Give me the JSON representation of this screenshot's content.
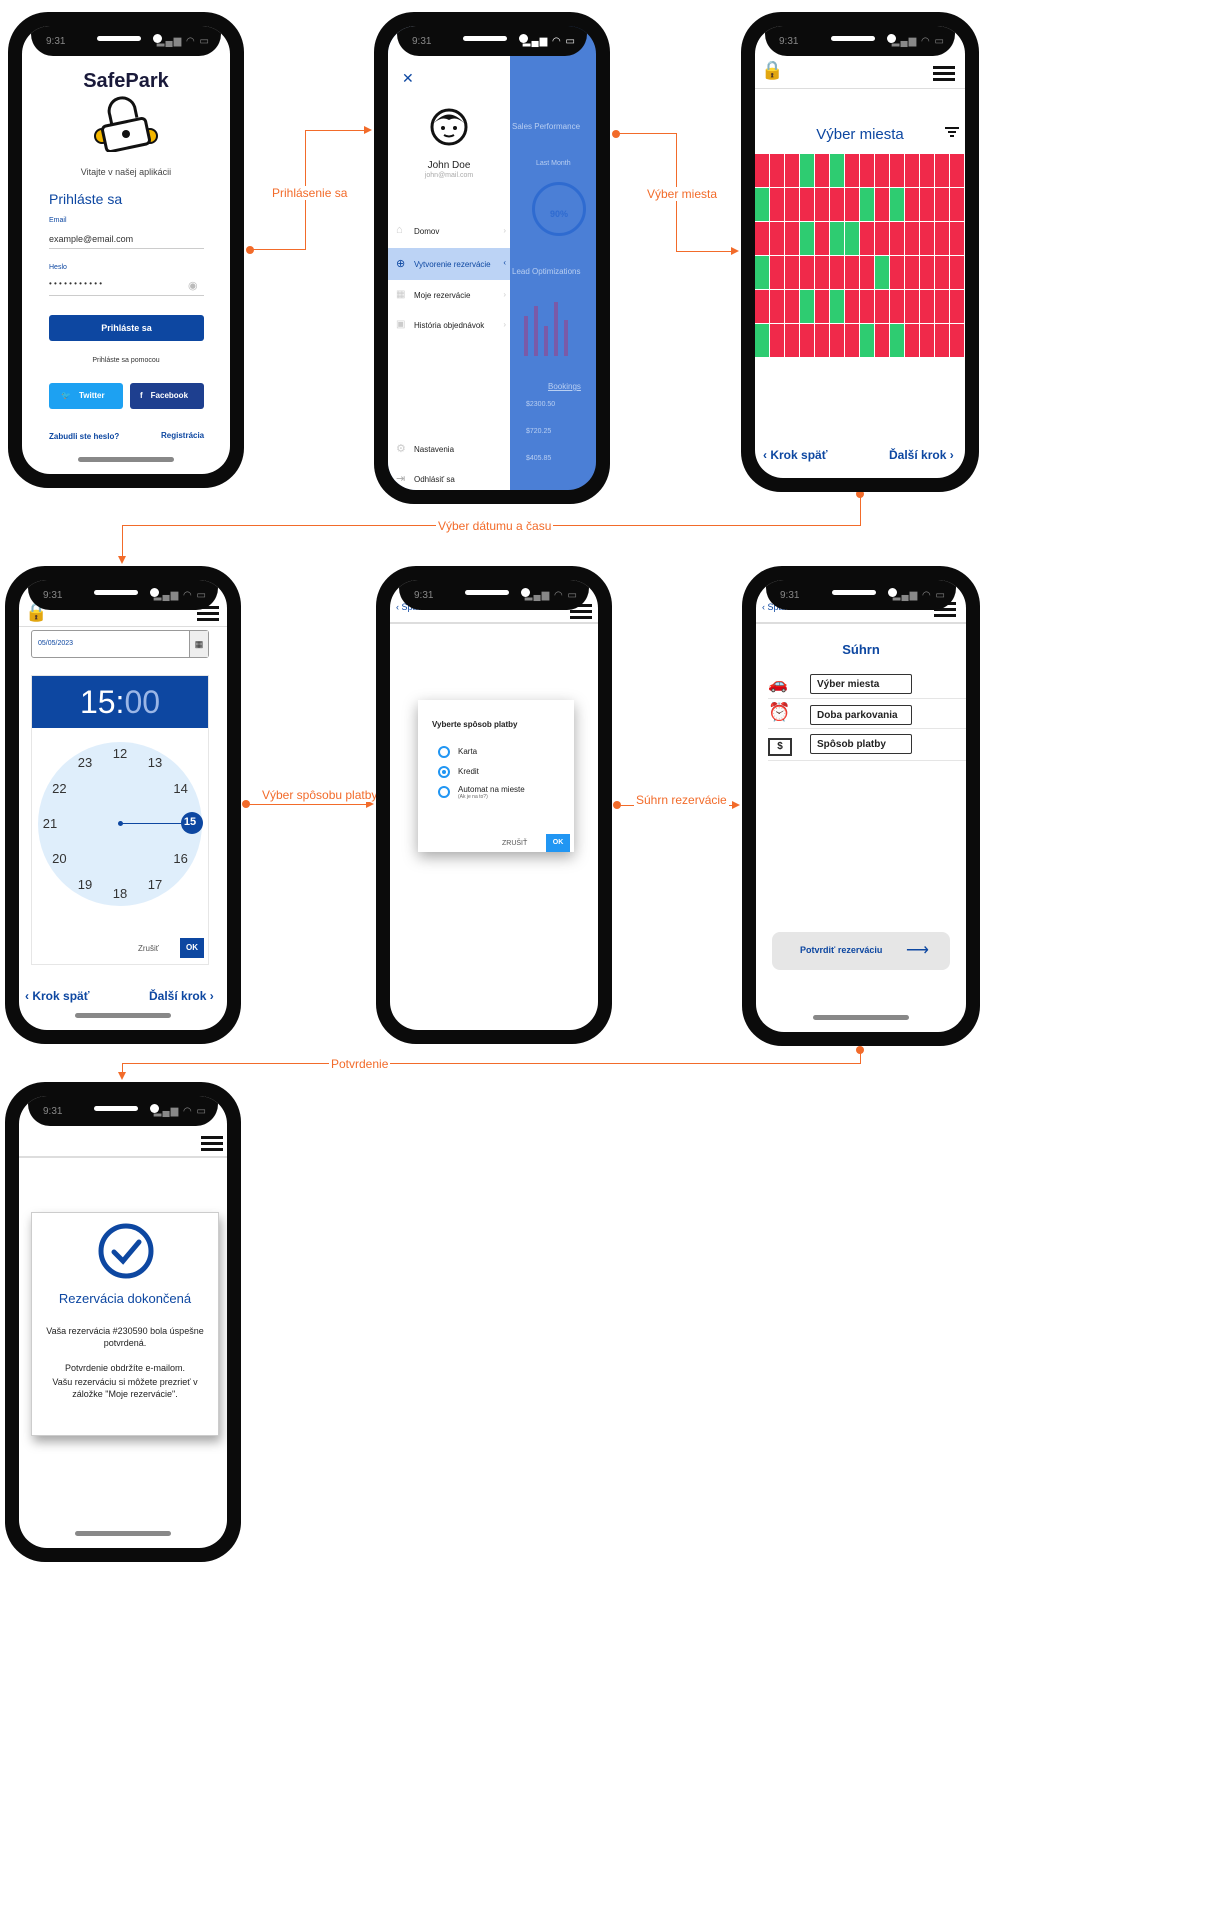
{
  "status_time": "9:31",
  "connectors": {
    "login": "Prihlásenie sa",
    "select_spot": "Výber miesta",
    "date_time": "Výber dátumu a času",
    "payment": "Výber spôsobu platby",
    "summary": "Súhrn rezervácie",
    "confirm": "Potvrdenie"
  },
  "login": {
    "app_name": "SafePark",
    "welcome": "Vitajte v našej aplikácii",
    "title": "Prihláste sa",
    "email_label": "Email",
    "email_value": "example@email.com",
    "password_label": "Heslo",
    "password_value": "• • • • • • • • • • •",
    "login_button": "Prihláste sa",
    "with_label": "Prihláste sa pomocou",
    "twitter": "Twitter",
    "facebook": "Facebook",
    "forgot": "Zabudli ste heslo?",
    "register": "Registrácia"
  },
  "menu": {
    "user_name": "John Doe",
    "user_email": "john@mail.com",
    "items": [
      {
        "label": "Domov"
      },
      {
        "label": "Vytvorenie rezervácie"
      },
      {
        "label": "Moje rezervácie"
      },
      {
        "label": "História objednávok"
      }
    ],
    "settings": "Nastavenia",
    "logout": "Odhlásiť sa",
    "bg_labels": {
      "sales": "Sales Performance",
      "last_month": "Last Month",
      "percent": "90%",
      "lead": "Lead Optimizations",
      "bookings": "Bookings",
      "v1": "$2300.50",
      "v2": "$720.25",
      "v3": "$405.85"
    }
  },
  "spot": {
    "title": "Výber miesta",
    "back": "Krok späť",
    "next": "Ďalší krok",
    "rows": [
      "RRRGRGRRRRRRRR",
      "GRRRRRRGRGRRRR",
      "RRRGRGGRRRRRRR",
      "GRRRRRRRGRRRRR",
      "RRRGRGRRRRRRRR",
      "GRRRRRRGRGRRRR"
    ],
    "colors": {
      "free": "#2ecc71",
      "taken": "#f0294a"
    }
  },
  "datetime": {
    "date_value": "05/05/2023",
    "hour": "15",
    "minute": "00",
    "colon": ":",
    "numbers": [
      "12",
      "13",
      "14",
      "15",
      "16",
      "17",
      "18",
      "19",
      "20",
      "21",
      "22",
      "23"
    ],
    "cancel": "Zrušiť",
    "ok": "OK",
    "back": "Krok späť",
    "next": "Ďalší krok"
  },
  "payment": {
    "back": "Späť",
    "title": "Vyberte spôsob platby",
    "options": [
      {
        "label": "Karta",
        "selected": false
      },
      {
        "label": "Kredit",
        "selected": true
      },
      {
        "label": "Automat na mieste",
        "note": "(Ak je na to?)",
        "selected": false
      }
    ],
    "cancel": "ZRUŠIŤ",
    "ok": "OK"
  },
  "summary": {
    "back": "Späť",
    "title": "Súhrn",
    "rows": [
      {
        "icon": "car-icon",
        "label": "Výber miesta"
      },
      {
        "icon": "alarm-clock-icon",
        "label": "Doba parkovania"
      },
      {
        "icon": "dollar-icon",
        "label": "Spôsob platby"
      }
    ],
    "confirm_button": "Potvrdiť rezerváciu"
  },
  "done": {
    "title": "Rezervácia dokončená",
    "line1": "Vaša rezervácia #230590 bola úspešne potvrdená.",
    "line2": "Potvrdenie obdržíte e-mailom.",
    "line3": "Vašu rezerváciu si môžete prezrieť v záložke \"Moje rezervácie\"."
  },
  "theme": {
    "brand": "#0d47a1",
    "accent": "#f26b2a"
  }
}
